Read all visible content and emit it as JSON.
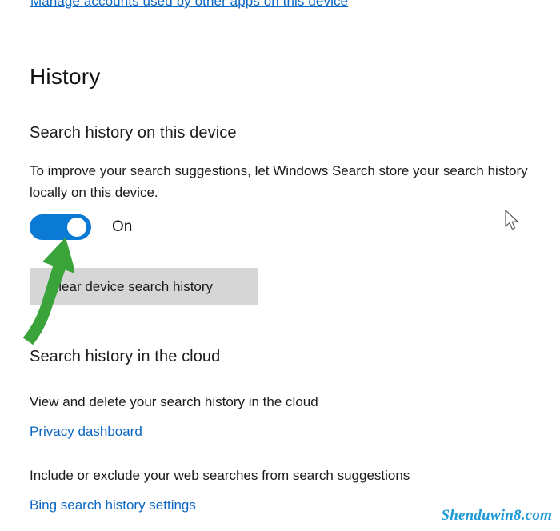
{
  "page": {
    "top_link": "Manage accounts used by other apps on this device",
    "section_title": "History",
    "subhead_device": "Search history on this device",
    "body_text": "To improve your search suggestions, let Windows Search store your search history locally on this device.",
    "toggle_state_label": "On",
    "clear_button_label": "Clear device search history",
    "subhead_cloud": "Search history in the cloud",
    "cloud_text": "View and delete your search history in the cloud",
    "privacy_link": "Privacy dashboard",
    "include_text": "Include or exclude your web searches from search suggestions",
    "bing_link": "Bing search history settings",
    "watermark": "Shenduwin8.com"
  },
  "colors": {
    "accent": "#0a7ad4",
    "link": "#0b66c3",
    "button_bg": "#d6d6d6",
    "annotation_arrow": "#3aa33a",
    "watermark": "#1c9ad6"
  },
  "icons": {
    "toggle": "toggle-switch-on-icon",
    "arrow": "green-arrow-annotation-icon",
    "cursor": "mouse-pointer-icon"
  }
}
